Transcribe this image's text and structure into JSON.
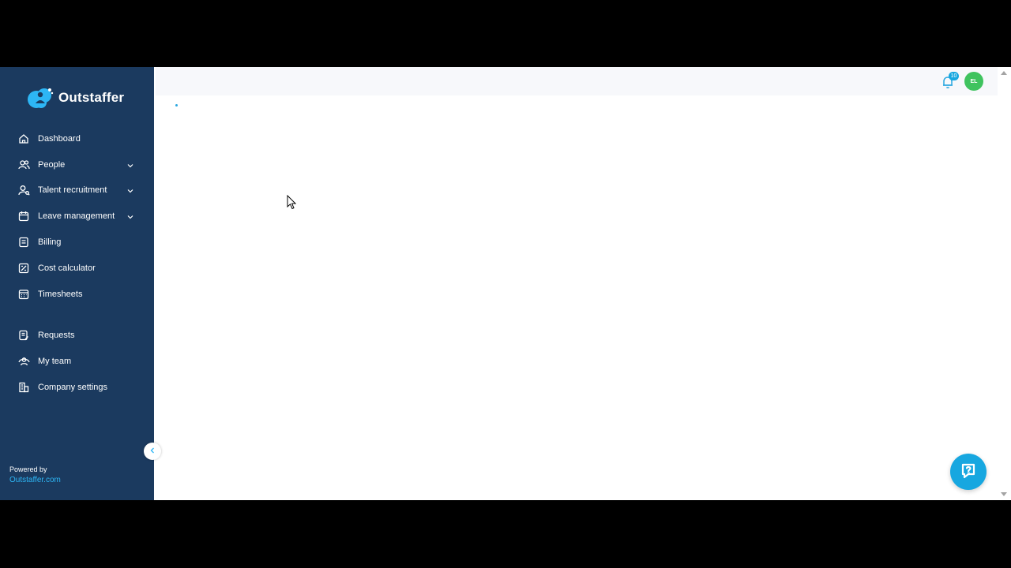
{
  "brand": {
    "name": "Outstaffer",
    "logo_icon": "cloud-person-logo",
    "sidebar_color": "#1b3a5f",
    "accent_color": "#17a7e0"
  },
  "sidebar": {
    "items": [
      {
        "label": "Dashboard",
        "icon": "home-icon",
        "expandable": false
      },
      {
        "label": "People",
        "icon": "people-icon",
        "expandable": true
      },
      {
        "label": "Talent recruitment",
        "icon": "person-search-icon",
        "expandable": true
      },
      {
        "label": "Leave management",
        "icon": "calendar-icon",
        "expandable": true
      },
      {
        "label": "Billing",
        "icon": "receipt-icon",
        "expandable": false
      },
      {
        "label": "Cost calculator",
        "icon": "calculator-icon",
        "expandable": false
      },
      {
        "label": "Timesheets",
        "icon": "timesheet-icon",
        "expandable": false
      },
      {
        "label": "Requests",
        "icon": "request-doc-icon",
        "expandable": false
      },
      {
        "label": "My team",
        "icon": "team-icon",
        "expandable": false
      },
      {
        "label": "Company settings",
        "icon": "building-icon",
        "expandable": false
      }
    ],
    "footer": {
      "powered_by": "Powered by",
      "link": "Outstaffer.com"
    }
  },
  "header": {
    "notification_count": "10",
    "avatar_initials": "EL",
    "avatar_color": "#3fc35e"
  }
}
